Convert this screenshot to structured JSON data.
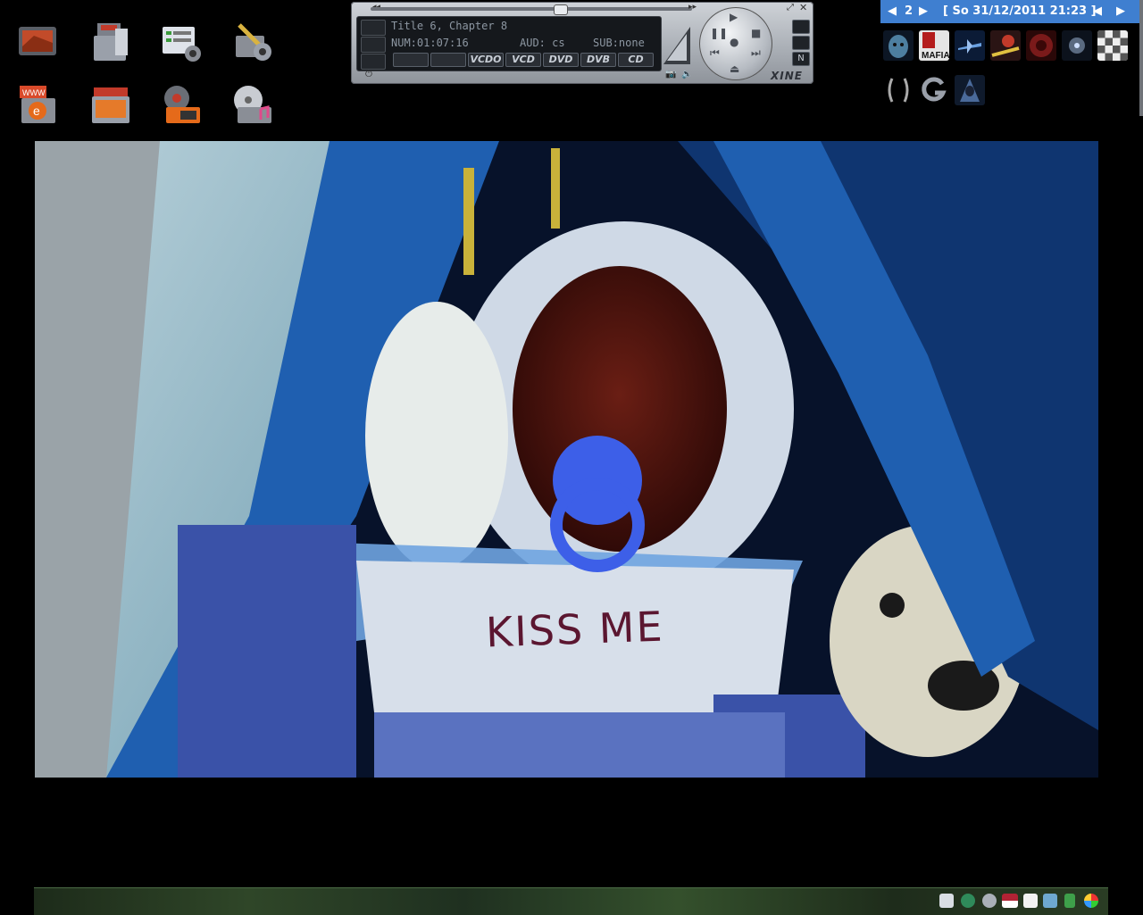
{
  "desktop": {
    "icons": [
      {
        "name": "workspace-icon"
      },
      {
        "name": "documents-folder-icon"
      },
      {
        "name": "settings-panel-icon"
      },
      {
        "name": "system-tools-icon"
      },
      {
        "name": "web-browser-icon"
      },
      {
        "name": "pictures-folder-icon"
      },
      {
        "name": "video-player-icon"
      },
      {
        "name": "music-player-icon"
      }
    ]
  },
  "player": {
    "title_line": "Title 6, Chapter 8",
    "time_line": "NUM:01:07:16",
    "audio_label": "AUD: cs",
    "subtitle_label": "SUB:none",
    "source_buttons": [
      "VCDO",
      "VCD",
      "DVD",
      "DVB",
      "CD"
    ],
    "brand": "XINE",
    "n_button": "N"
  },
  "pager": {
    "workspace_number": "2",
    "datetime": "[ So 31/12/2011 21:23 ]"
  },
  "launchers": [
    {
      "name": "mask-game-icon",
      "color": "#2a4a6a"
    },
    {
      "name": "mafia-game-icon",
      "color": "#c8c8c8",
      "label": "MAFIA"
    },
    {
      "name": "jet-game-icon",
      "color": "#244a7a"
    },
    {
      "name": "racing-game-icon",
      "color": "#5a2a2a"
    },
    {
      "name": "red-orb-game-icon",
      "color": "#4a0f10"
    },
    {
      "name": "space-game-icon",
      "color": "#1b2535"
    },
    {
      "name": "chess-icon",
      "color": "#bbbbbb"
    },
    {
      "name": "oblivion-game-icon",
      "color": "#222222"
    },
    {
      "name": "g-app-icon",
      "color": "#222222"
    },
    {
      "name": "hooded-game-icon",
      "color": "#20304a"
    }
  ],
  "video": {
    "bib_text": "KISS ME"
  },
  "colors": {
    "pager_bg": "#3f7fd0",
    "video_blue": "#1f5fb0",
    "pacifier": "#3d5fe8"
  }
}
